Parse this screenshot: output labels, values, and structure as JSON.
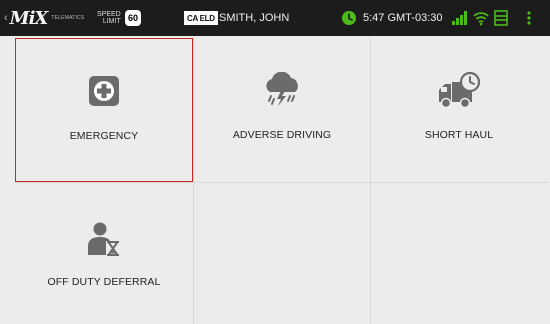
{
  "status_bar": {
    "logo_text": "MiX",
    "logo_subtext": "TELEMATICS",
    "speed_label_line1": "SPEED",
    "speed_label_line2": "LIMIT",
    "speed_limit": "60",
    "eld_badge": "CA ELD",
    "driver_name": "SMITH, JOHN",
    "time": "5:47 GMT-03:30",
    "icons": [
      "clock-alert-icon",
      "signal-icon",
      "wifi-icon",
      "schedule-icon",
      "more-vert-icon"
    ],
    "accent_color": "#4cbb17"
  },
  "tiles": [
    {
      "label": "EMERGENCY",
      "icon": "medical-cross-icon",
      "selected": true
    },
    {
      "label": "ADVERSE DRIVING",
      "icon": "storm-cloud-icon",
      "selected": false
    },
    {
      "label": "SHORT HAUL",
      "icon": "truck-clock-icon",
      "selected": false
    },
    {
      "label": "OFF DUTY DEFERRAL",
      "icon": "person-hourglass-icon",
      "selected": false
    }
  ],
  "colors": {
    "selected_border": "#c62828",
    "icon_gray": "#6b6b6b"
  }
}
